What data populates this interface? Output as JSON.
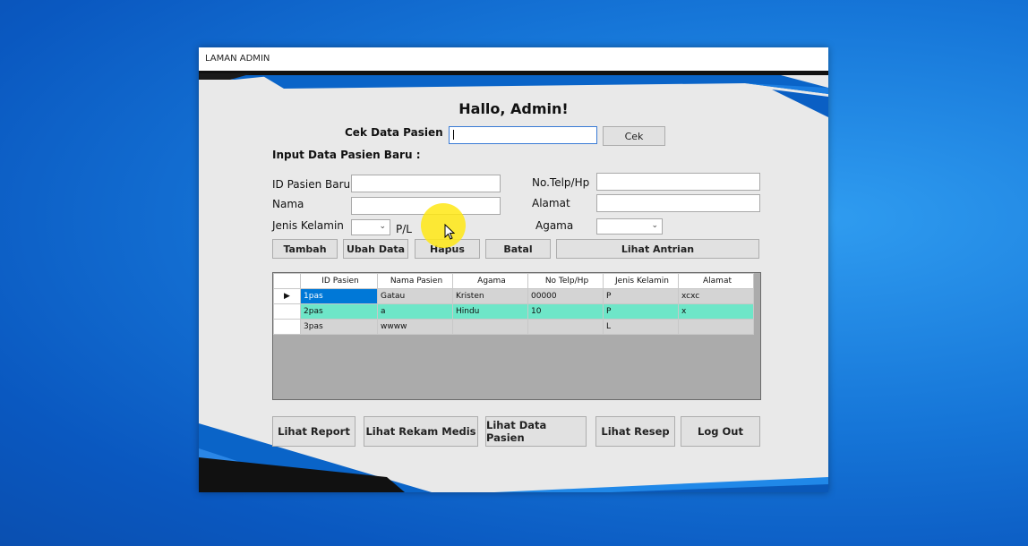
{
  "window": {
    "title": "LAMAN ADMIN"
  },
  "greeting": "Hallo, Admin!",
  "cek": {
    "label": "Cek Data Pasien",
    "button": "Cek",
    "value": ""
  },
  "input_section": "Input Data Pasien Baru :",
  "form": {
    "id_label": "ID Pasien Baru",
    "nama_label": "Nama",
    "jk_label": "Jenis Kelamin",
    "jk_hint": "P/L",
    "telp_label": "No.Telp/Hp",
    "alamat_label": "Alamat",
    "agama_label": "Agama"
  },
  "actions": [
    "Tambah",
    "Ubah Data",
    "Hapus",
    "Batal",
    "Lihat Antrian"
  ],
  "table": {
    "columns": [
      "ID Pasien",
      "Nama Pasien",
      "Agama",
      "No Telp/Hp",
      "Jenis Kelamin",
      "Alamat"
    ],
    "rows": [
      [
        "1pas",
        "Gatau",
        "Kristen",
        "00000",
        "P",
        "xcxc"
      ],
      [
        "2pas",
        "a",
        "Hindu",
        "10",
        "P",
        "x"
      ],
      [
        "3pas",
        "wwww",
        "",
        "",
        "L",
        ""
      ]
    ]
  },
  "nav": [
    "Lihat Report",
    "Lihat Rekam Medis",
    "Lihat Data Pasien",
    "Lihat Resep",
    "Log Out"
  ],
  "colors": {
    "accent_blue": "#0a64c8",
    "selected_cell": "#0078d7",
    "highlight_row": "#6ee6c8"
  }
}
